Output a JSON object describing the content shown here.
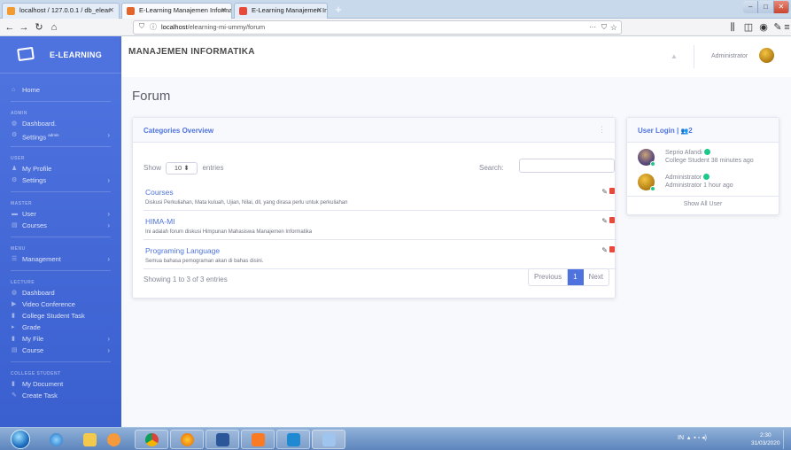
{
  "browser": {
    "tabs": [
      {
        "label": "localhost / 127.0.0.1 / db_elear"
      },
      {
        "label": "E-Learning Manajemen Informa"
      },
      {
        "label": "E-Learning Manajemen Informa"
      }
    ],
    "url_host": "localhost",
    "url_path": "/elearning-mi-ummy/forum",
    "url_more": "···"
  },
  "sidebar": {
    "brand": "E-LEARNING",
    "home": "Home",
    "sections": [
      {
        "heading": "ADMIN",
        "items": [
          {
            "label": "Dashboard.",
            "icon": "dashboard-icon",
            "arrow": false
          },
          {
            "label": "Settings",
            "sup": "admin",
            "icon": "gear-icon",
            "arrow": true
          }
        ]
      },
      {
        "heading": "USER",
        "items": [
          {
            "label": "My Profile",
            "icon": "user-icon",
            "arrow": false
          },
          {
            "label": "Settings",
            "icon": "gear-icon",
            "arrow": true
          }
        ]
      },
      {
        "heading": "MASTER",
        "items": [
          {
            "label": "User",
            "icon": "users-icon",
            "arrow": true
          },
          {
            "label": "Courses",
            "icon": "book-icon",
            "arrow": true
          }
        ]
      },
      {
        "heading": "MENU",
        "items": [
          {
            "label": "Management",
            "icon": "list-icon",
            "arrow": true
          }
        ]
      },
      {
        "heading": "LECTURE",
        "items": [
          {
            "label": "Dashboard",
            "icon": "dashboard-icon",
            "arrow": false
          },
          {
            "label": "Video Conference",
            "icon": "video-icon",
            "arrow": false
          },
          {
            "label": "College Student Task",
            "icon": "file-icon",
            "arrow": false
          },
          {
            "label": "Grade",
            "icon": "grade-icon",
            "arrow": false
          },
          {
            "label": "My File",
            "icon": "file-icon",
            "arrow": true
          },
          {
            "label": "Course",
            "icon": "book-icon",
            "arrow": true
          }
        ]
      },
      {
        "heading": "COLLEGE STUDENT",
        "items": [
          {
            "label": "My Document",
            "icon": "file-icon",
            "arrow": false
          },
          {
            "label": "Create Task",
            "icon": "task-icon",
            "arrow": false
          }
        ]
      }
    ]
  },
  "topbar": {
    "title": "MANAJEMEN INFORMATIKA",
    "user": "Administrator"
  },
  "page": {
    "title": "Forum"
  },
  "categories": {
    "heading": "Categories Overview",
    "show_label": "Show",
    "show_value": "10",
    "entries_label": "entries",
    "search_label": "Search:",
    "rows": [
      {
        "title": "Courses",
        "desc": "Diskusi Perkuliahan, Mata kuluah, Ujian, Nilai, dll, yang dirasa perlu untuk perkuliahan"
      },
      {
        "title": "HIMA-MI",
        "desc": "Ini adalah forum diskusi Himpunan Mahasiswa Manajemen Informatika"
      },
      {
        "title": "Programing Language",
        "desc": "Semua bahasa pemograman akan di bahas disini."
      }
    ],
    "showing": "Showing 1 to 3 of 3 entries",
    "pager": {
      "prev": "Previous",
      "current": "1",
      "next": "Next"
    }
  },
  "user_login": {
    "heading": "User Login |",
    "count": "2",
    "users": [
      {
        "name": "Seprio Afandi",
        "status": "College Student 38 minutes ago"
      },
      {
        "name": "Administrator",
        "status": "Administrator 1 hour ago"
      }
    ],
    "show_all": "Show All User"
  },
  "taskbar": {
    "lang": "IN",
    "time": "2:30",
    "date": "31/03/2020"
  },
  "colors": {
    "primary": "#4e73df",
    "success": "#1cc88a",
    "danger": "#e74a3b"
  }
}
